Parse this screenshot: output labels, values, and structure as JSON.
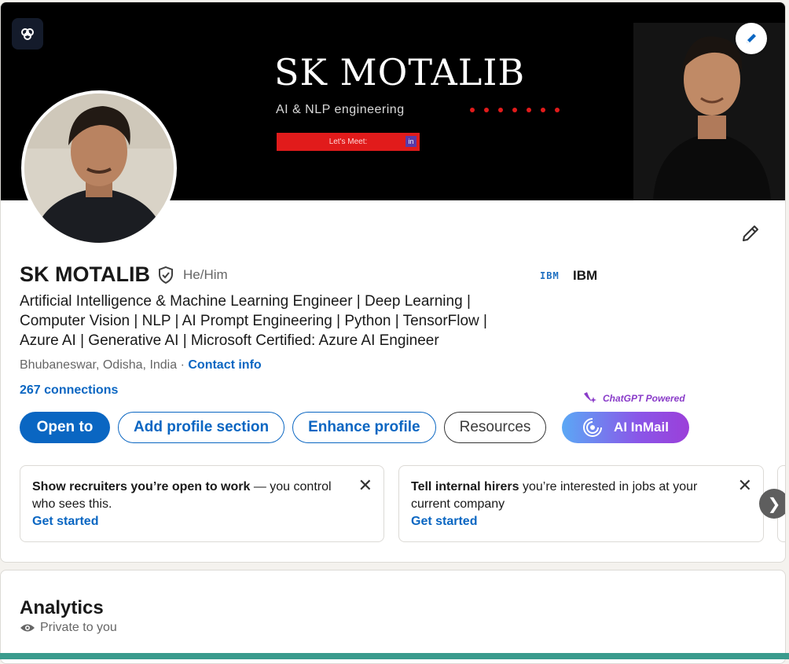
{
  "banner": {
    "title": "SK MOTALIB",
    "subtitle": "AI & NLP  engineering",
    "cta": "Let's Meet:"
  },
  "profile": {
    "name": "SK MOTALIB",
    "pronouns": "He/Him",
    "company_logo_text": "IBM",
    "company": "IBM",
    "headline": "Artificial Intelligence & Machine Learning Engineer | Deep Learning | Computer Vision | NLP | AI Prompt Engineering | Python | TensorFlow | Azure AI | Generative AI | Microsoft Certified: Azure AI Engineer",
    "location": "Bhubaneswar, Odisha, India",
    "location_sep": " · ",
    "contact_info": "Contact info",
    "connections": "267 connections"
  },
  "actions": {
    "open_to": "Open to",
    "add_section": "Add profile section",
    "enhance": "Enhance profile",
    "resources": "Resources",
    "chatgpt_tag": "ChatGPT Powered",
    "ai_inmail": "AI InMail"
  },
  "promos": [
    {
      "bold": "Show recruiters you’re open to work",
      "rest": " — you control who sees this.",
      "cta": "Get started",
      "close": "✕"
    },
    {
      "bold": "Tell internal hirers",
      "rest": " you’re interested in jobs at your current company",
      "cta": "Get started",
      "close": "✕"
    }
  ],
  "carousel_next": "❯",
  "analytics": {
    "title": "Analytics",
    "visibility": "Private to you"
  },
  "colors": {
    "brand_blue": "#0a66c2",
    "banner_red": "#e11b1b",
    "inmail_gradient_start": "#5ba8f5",
    "inmail_gradient_end": "#9b3fd9"
  },
  "icons": {
    "brain": "brain-icon",
    "pencil": "pencil-icon",
    "shield": "verified-shield-icon",
    "eye": "eye-icon",
    "close": "close-icon",
    "chevron": "chevron-right-icon"
  }
}
